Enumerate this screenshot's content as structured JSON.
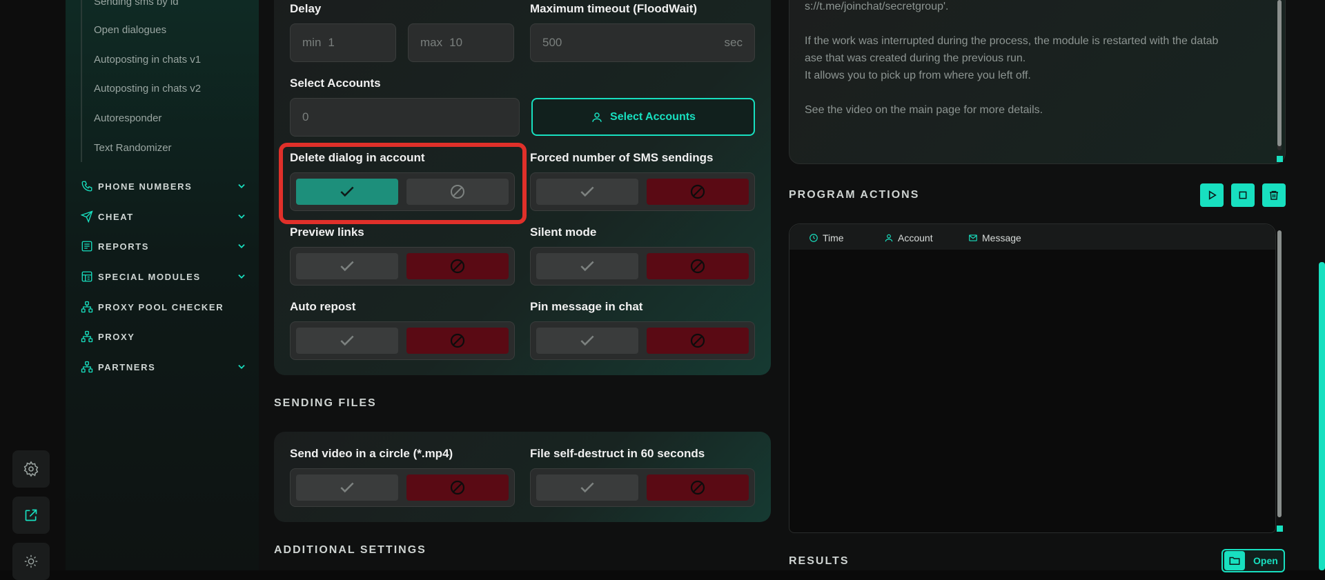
{
  "sidebar": {
    "sub_items": [
      {
        "label": "Sending sms by id"
      },
      {
        "label": "Open dialogues"
      },
      {
        "label": "Autoposting in chats v1"
      },
      {
        "label": "Autoposting in chats v2"
      },
      {
        "label": "Autoresponder"
      },
      {
        "label": "Text Randomizer"
      }
    ],
    "nav": [
      {
        "label": "PHONE NUMBERS",
        "icon": "phone-icon",
        "has_chevron": true
      },
      {
        "label": "CHEAT",
        "icon": "send-plane-icon",
        "has_chevron": true
      },
      {
        "label": "REPORTS",
        "icon": "report-icon",
        "has_chevron": true
      },
      {
        "label": "SPECIAL MODULES",
        "icon": "modules-icon",
        "has_chevron": true
      },
      {
        "label": "PROXY POOL CHECKER",
        "icon": "network-icon",
        "has_chevron": false
      },
      {
        "label": "PROXY",
        "icon": "network-icon",
        "has_chevron": false
      },
      {
        "label": "PARTNERS",
        "icon": "network-icon",
        "has_chevron": true
      }
    ]
  },
  "rail": {
    "icons": [
      "gear-icon",
      "external-link-icon",
      "theme-icon"
    ]
  },
  "settings": {
    "delay_label": "Delay",
    "delay_min_prefix": "min",
    "delay_min_value": "1",
    "delay_max_prefix": "max",
    "delay_max_value": "10",
    "timeout_label": "Maximum timeout (FloodWait)",
    "timeout_value": "500",
    "timeout_unit": "sec",
    "accounts_label": "Select Accounts",
    "accounts_value": "0",
    "select_accounts_button": "Select Accounts",
    "toggles": [
      {
        "label": "Delete dialog in account",
        "state": "on"
      },
      {
        "label": "Forced number of SMS sendings",
        "state": "off"
      },
      {
        "label": "Preview links",
        "state": "off"
      },
      {
        "label": "Silent mode",
        "state": "off"
      },
      {
        "label": "Auto repost",
        "state": "off"
      },
      {
        "label": "Pin message in chat",
        "state": "off"
      }
    ]
  },
  "sending_files": {
    "title": "SENDING FILES",
    "toggles": [
      {
        "label": "Send video in a circle (*.mp4)",
        "state": "off"
      },
      {
        "label": "File self-destruct in 60 seconds",
        "state": "off"
      }
    ]
  },
  "additional_settings": {
    "title": "ADDITIONAL SETTINGS"
  },
  "help_text": {
    "lines": [
      "s://t.me/joinchat/secretgroup'.",
      "",
      "If the work was interrupted during the process, the module is restarted with the datab",
      "ase that was created during the previous run.",
      "It allows you to pick up from where you left off.",
      "",
      "See the video on the main page for more details."
    ]
  },
  "program_actions": {
    "title": "PROGRAM ACTIONS",
    "columns": [
      {
        "label": "Time",
        "icon": "clock-icon"
      },
      {
        "label": "Account",
        "icon": "user-icon"
      },
      {
        "label": "Message",
        "icon": "mail-icon"
      }
    ]
  },
  "results": {
    "title": "RESULTS",
    "open_button": "Open"
  },
  "colors": {
    "accent": "#18e0c0",
    "toggle_on": "#1d8f7b",
    "toggle_off_red": "#5a0a14",
    "highlight": "#e0302a"
  }
}
